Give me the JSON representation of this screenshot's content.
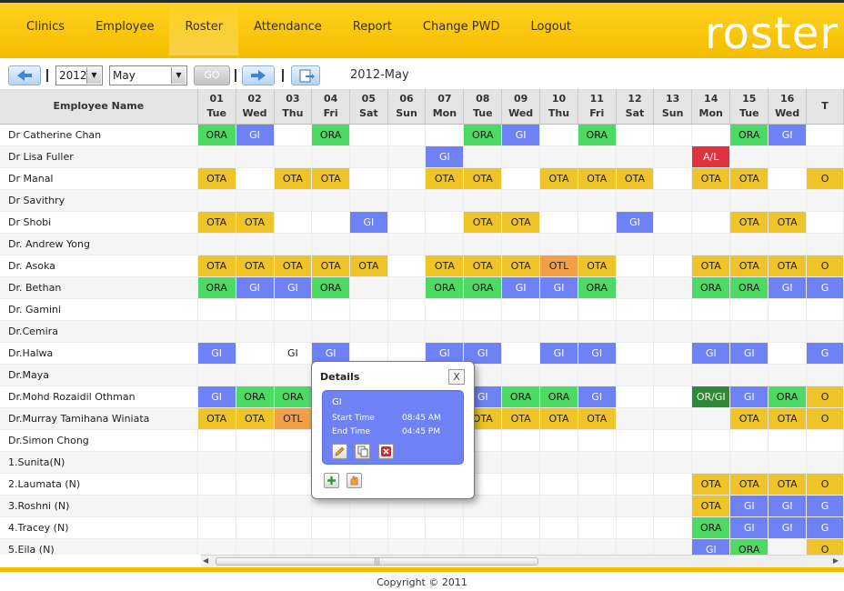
{
  "nav": {
    "items": [
      "Clinics",
      "Employee",
      "Roster",
      "Attendance",
      "Report",
      "Change PWD",
      "Logout"
    ],
    "active": "Roster"
  },
  "logo": "roster",
  "toolbar": {
    "year": "2012",
    "month": "May",
    "go_label": "GO",
    "period_label": "2012-May"
  },
  "grid": {
    "name_header": "Employee Name",
    "days": [
      {
        "num": "01",
        "dow": "Tue"
      },
      {
        "num": "02",
        "dow": "Wed"
      },
      {
        "num": "03",
        "dow": "Thu"
      },
      {
        "num": "04",
        "dow": "Fri"
      },
      {
        "num": "05",
        "dow": "Sat"
      },
      {
        "num": "06",
        "dow": "Sun"
      },
      {
        "num": "07",
        "dow": "Mon"
      },
      {
        "num": "08",
        "dow": "Tue"
      },
      {
        "num": "09",
        "dow": "Wed"
      },
      {
        "num": "10",
        "dow": "Thu"
      },
      {
        "num": "11",
        "dow": "Fri"
      },
      {
        "num": "12",
        "dow": "Sat"
      },
      {
        "num": "13",
        "dow": "Sun"
      },
      {
        "num": "14",
        "dow": "Mon"
      },
      {
        "num": "15",
        "dow": "Tue"
      },
      {
        "num": "16",
        "dow": "Wed"
      },
      {
        "num": "",
        "dow": "T"
      }
    ],
    "rows": [
      {
        "name": "Dr Catherine Chan",
        "cells": [
          "ORA",
          "GI",
          "",
          "ORA",
          "",
          "",
          "",
          "ORA",
          "GI",
          "",
          "ORA",
          "",
          "",
          "",
          "ORA",
          "GI",
          ""
        ]
      },
      {
        "name": "Dr Lisa Fuller",
        "cells": [
          "",
          "",
          "",
          "",
          "",
          "",
          "GI",
          "",
          "",
          "",
          "",
          "",
          "",
          "A/L",
          "",
          "",
          ""
        ]
      },
      {
        "name": "Dr Manal",
        "cells": [
          "OTA",
          "",
          "OTA",
          "OTA",
          "",
          "",
          "OTA",
          "OTA",
          "",
          "OTA",
          "OTA",
          "OTA",
          "",
          "OTA",
          "OTA",
          "",
          "O"
        ]
      },
      {
        "name": "Dr Savithry",
        "cells": [
          "",
          "",
          "",
          "",
          "",
          "",
          "",
          "",
          "",
          "",
          "",
          "",
          "",
          "",
          "",
          "",
          ""
        ]
      },
      {
        "name": "Dr Shobi",
        "cells": [
          "OTA",
          "OTA",
          "",
          "",
          "GI",
          "",
          "",
          "OTA",
          "OTA",
          "",
          "",
          "GI",
          "",
          "",
          "OTA",
          "OTA",
          ""
        ]
      },
      {
        "name": "Dr. Andrew Yong",
        "cells": [
          "",
          "",
          "",
          "",
          "",
          "",
          "",
          "",
          "",
          "",
          "",
          "",
          "",
          "",
          "",
          "",
          ""
        ]
      },
      {
        "name": "Dr. Asoka",
        "cells": [
          "OTA",
          "OTA",
          "OTA",
          "OTA",
          "OTA",
          "",
          "OTA",
          "OTA",
          "OTA",
          "OTL",
          "OTA",
          "",
          "",
          "OTA",
          "OTA",
          "OTA",
          "O"
        ]
      },
      {
        "name": "Dr. Bethan",
        "cells": [
          "ORA",
          "GI",
          "GI",
          "ORA",
          "",
          "",
          "ORA",
          "ORA",
          "GI",
          "GI",
          "ORA",
          "",
          "",
          "ORA",
          "ORA",
          "GI",
          "G"
        ]
      },
      {
        "name": "Dr. Gamini",
        "cells": [
          "",
          "",
          "",
          "",
          "",
          "",
          "",
          "",
          "",
          "",
          "",
          "",
          "",
          "",
          "",
          "",
          ""
        ]
      },
      {
        "name": "Dr.Cemira",
        "cells": [
          "",
          "",
          "",
          "",
          "",
          "",
          "",
          "",
          "",
          "",
          "",
          "",
          "",
          "",
          "",
          "",
          ""
        ]
      },
      {
        "name": "Dr.Halwa",
        "cells": [
          "GI",
          "",
          "GI*",
          "GI",
          "",
          "",
          "GI",
          "GI",
          "",
          "GI",
          "GI",
          "",
          "",
          "GI",
          "GI",
          "",
          "G"
        ]
      },
      {
        "name": "Dr.Maya",
        "cells": [
          "",
          "",
          "",
          "",
          "",
          "",
          "",
          "",
          "",
          "",
          "",
          "",
          "",
          "",
          "",
          "",
          ""
        ]
      },
      {
        "name": "Dr.Mohd Rozaidil Othman",
        "cells": [
          "GI",
          "ORA",
          "ORA",
          "",
          "",
          "",
          "",
          "GI",
          "ORA",
          "ORA",
          "GI",
          "",
          "",
          "OR/GI",
          "GI",
          "ORA",
          "O"
        ]
      },
      {
        "name": "Dr.Murray Tamihana Winiata",
        "cells": [
          "OTA",
          "OTA",
          "OTL",
          "",
          "",
          "",
          "",
          "OTA",
          "OTA",
          "OTA",
          "OTA",
          "",
          "",
          "",
          "OTA",
          "OTA",
          "O"
        ]
      },
      {
        "name": "Dr.Simon Chong",
        "cells": [
          "",
          "",
          "",
          "",
          "",
          "",
          "",
          "",
          "",
          "",
          "",
          "",
          "",
          "",
          "",
          "",
          ""
        ]
      },
      {
        "name": "1.Sunita(N)",
        "cells": [
          "",
          "",
          "",
          "",
          "",
          "",
          "",
          "",
          "",
          "",
          "",
          "",
          "",
          "",
          "",
          "",
          ""
        ]
      },
      {
        "name": "2.Laumata (N)",
        "cells": [
          "",
          "",
          "",
          "",
          "",
          "",
          "",
          "",
          "",
          "",
          "",
          "",
          "",
          "OTA",
          "OTA",
          "OTA",
          "O"
        ]
      },
      {
        "name": "3.Roshni (N)",
        "cells": [
          "",
          "",
          "",
          "",
          "",
          "",
          "",
          "",
          "",
          "",
          "",
          "",
          "",
          "OTA",
          "GI",
          "GI",
          "G"
        ]
      },
      {
        "name": "4.Tracey (N)",
        "cells": [
          "",
          "",
          "",
          "",
          "",
          "",
          "",
          "",
          "",
          "",
          "",
          "",
          "",
          "ORA",
          "GI",
          "GI",
          "G"
        ]
      },
      {
        "name": "5.Eila (N)",
        "cells": [
          "",
          "",
          "",
          "",
          "",
          "",
          "",
          "",
          "",
          "",
          "",
          "",
          "",
          "GI",
          "ORA",
          "",
          "O"
        ]
      }
    ]
  },
  "details": {
    "title": "Details",
    "close": "X",
    "code": "GI",
    "start_label": "Start Time",
    "start_value": "08:45 AM",
    "end_label": "End Time",
    "end_value": "04:45 PM"
  },
  "footer": "Copyright © 2011",
  "colors": {
    "header": "#f5bd00",
    "ORA": "#4cd964",
    "GI": "#6f82f5",
    "OTA": "#eec428",
    "OTL": "#f2a048",
    "AL": "#e0323e",
    "ORGI": "#2f8a38"
  }
}
